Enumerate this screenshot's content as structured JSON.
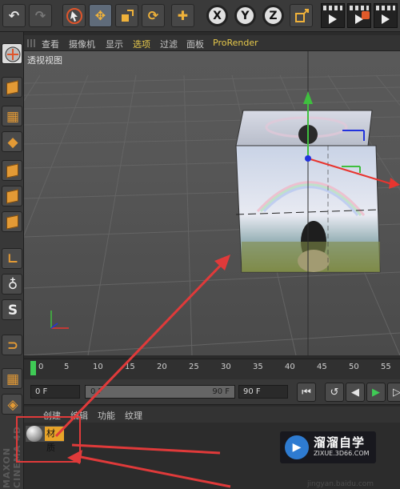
{
  "toolbar": {
    "undo_icon": "undo-icon",
    "redo_icon": "redo-icon",
    "tools": [
      "select-arrow-icon",
      "move-icon",
      "scale-icon",
      "rotate-icon",
      "move-cross-icon"
    ],
    "axis_x": "X",
    "axis_y": "Y",
    "axis_z": "Z",
    "coord_icon": "coordinate-system-icon",
    "render_buttons": [
      "render-view-icon",
      "render-to-picture-viewer-icon",
      "render-settings-icon"
    ]
  },
  "viewport": {
    "menu": [
      "查看",
      "摄像机",
      "显示",
      "选项",
      "过滤",
      "面板",
      "ProRender"
    ],
    "highlight_menu": [
      "选项",
      "ProRender"
    ],
    "label": "透视视图",
    "colors": {
      "axis_x": "#e8352f",
      "axis_y": "#3fbf3f",
      "axis_z": "#2233dd",
      "annotation": "#e03a3a"
    }
  },
  "timeline": {
    "ticks": [
      "0",
      "5",
      "10",
      "15",
      "20",
      "25",
      "30",
      "35",
      "40",
      "45",
      "50",
      "55"
    ],
    "cursor_frame": "0"
  },
  "controls": {
    "start_field": "0 F",
    "slider_start": "0 F",
    "slider_end": "90 F",
    "end_field": "90 F",
    "buttons": [
      "go-to-start-icon",
      "record-icon",
      "previous-frame-icon",
      "play-icon",
      "next-frame-icon"
    ]
  },
  "material_manager": {
    "menu": [
      "创建",
      "编辑",
      "功能",
      "纹理"
    ],
    "materials": [
      {
        "name": "材质"
      }
    ],
    "brand": "MAXON CINEMA 4D"
  },
  "watermark": {
    "title": "溜溜自学",
    "subtitle": "ZIXUE.3D66.COM",
    "footer": "jingyan.baidu.com"
  }
}
